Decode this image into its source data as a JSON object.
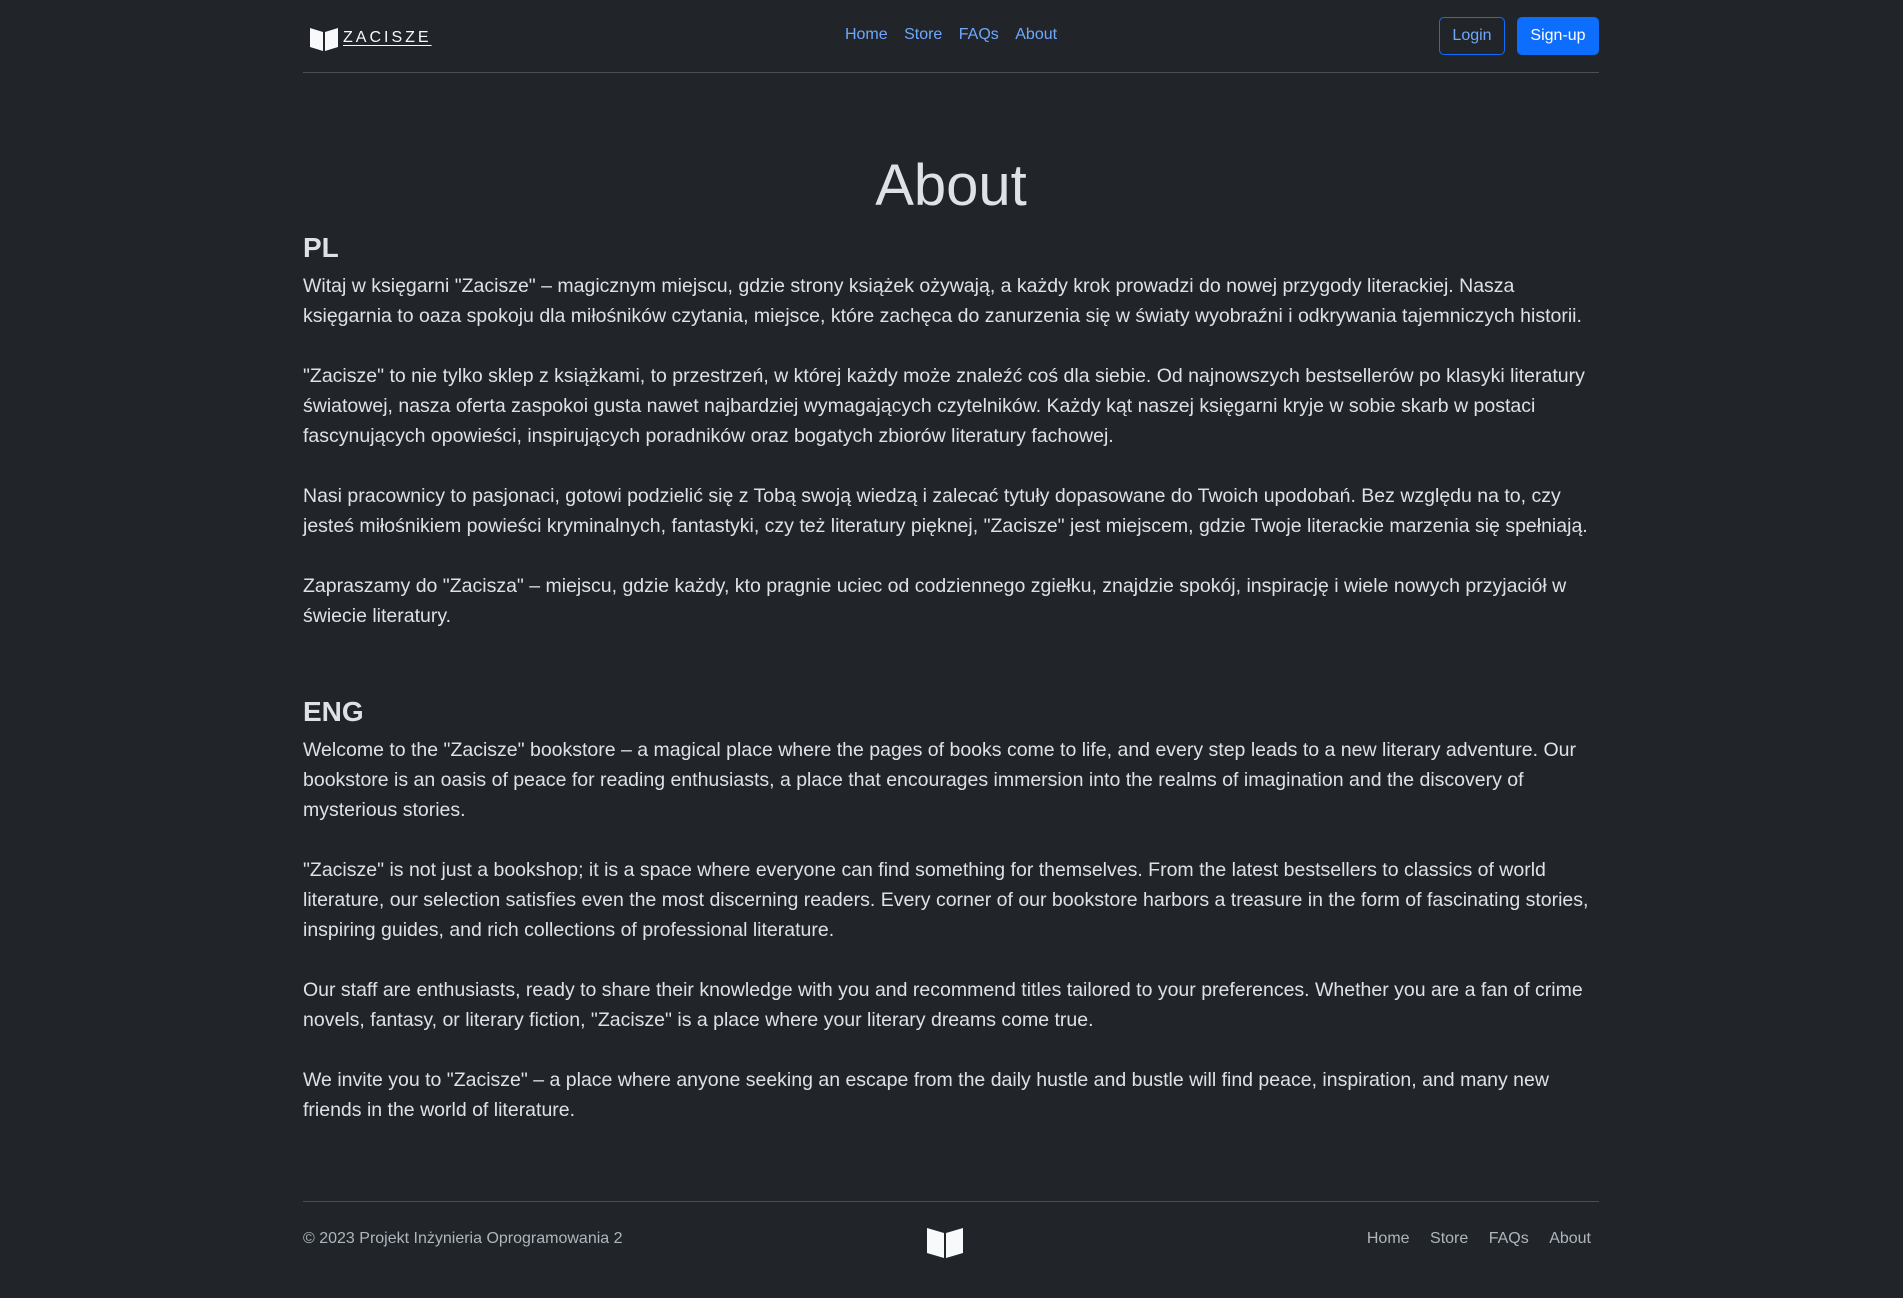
{
  "header": {
    "brand": "ZACISZE",
    "brand_icon": "open-book-icon",
    "nav": [
      "Home",
      "Store",
      "FAQs",
      "About"
    ],
    "login_label": "Login",
    "signup_label": "Sign-up"
  },
  "main": {
    "title": "About",
    "sections": [
      {
        "heading": "PL",
        "paragraphs": [
          "Witaj w księgarni \"Zacisze\" – magicznym miejscu, gdzie strony książek ożywają, a każdy krok prowadzi do nowej przygody literackiej. Nasza księgarnia to oaza spokoju dla miłośników czytania, miejsce, które zachęca do zanurzenia się w światy wyobraźni i odkrywania tajemniczych historii.",
          "\"Zacisze\" to nie tylko sklep z książkami, to przestrzeń, w której każdy może znaleźć coś dla siebie. Od najnowszych bestsellerów po klasyki literatury światowej, nasza oferta zaspokoi gusta nawet najbardziej wymagających czytelników. Każdy kąt naszej księgarni kryje w sobie skarb w postaci fascynujących opowieści, inspirujących poradników oraz bogatych zbiorów literatury fachowej.",
          "Nasi pracownicy to pasjonaci, gotowi podzielić się z Tobą swoją wiedzą i zalecać tytuły dopasowane do Twoich upodobań. Bez względu na to, czy jesteś miłośnikiem powieści kryminalnych, fantastyki, czy też literatury pięknej, \"Zacisze\" jest miejscem, gdzie Twoje literackie marzenia się spełniają.",
          "Zapraszamy do \"Zacisza\" – miejscu, gdzie każdy, kto pragnie uciec od codziennego zgiełku, znajdzie spokój, inspirację i wiele nowych przyjaciół w świecie literatury."
        ]
      },
      {
        "heading": "ENG",
        "paragraphs": [
          "Welcome to the \"Zacisze\" bookstore – a magical place where the pages of books come to life, and every step leads to a new literary adventure. Our bookstore is an oasis of peace for reading enthusiasts, a place that encourages immersion into the realms of imagination and the discovery of mysterious stories.",
          "\"Zacisze\" is not just a bookshop; it is a space where everyone can find something for themselves. From the latest bestsellers to classics of world literature, our selection satisfies even the most discerning readers. Every corner of our bookstore harbors a treasure in the form of fascinating stories, inspiring guides, and rich collections of professional literature.",
          "Our staff are enthusiasts, ready to share their knowledge with you and recommend titles tailored to your preferences. Whether you are a fan of crime novels, fantasy, or literary fiction, \"Zacisze\" is a place where your literary dreams come true.",
          "We invite you to \"Zacisze\" – a place where anyone seeking an escape from the daily hustle and bustle will find peace, inspiration, and many new friends in the world of literature."
        ]
      }
    ]
  },
  "footer": {
    "copyright": "© 2023 Projekt Inżynieria Oprogramowania 2",
    "logo_icon": "open-book-icon",
    "nav": [
      "Home",
      "Store",
      "FAQs",
      "About"
    ]
  },
  "colors": {
    "background": "#212529",
    "text": "#dee2e6",
    "link": "#6ea8fe",
    "primary": "#0d6efd",
    "muted": "#adb5bd"
  }
}
